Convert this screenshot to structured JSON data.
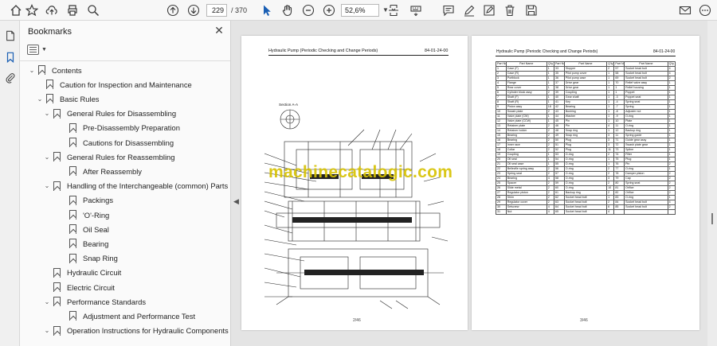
{
  "toolbar": {
    "page_current": "229",
    "page_total": "/ 370",
    "zoom": "52,6%"
  },
  "bookmarks_panel": {
    "title": "Bookmarks",
    "items": [
      {
        "label": "Contents",
        "level": 0,
        "expanded": true
      },
      {
        "label": "Caution for Inspection and Maintenance",
        "level": 1,
        "expanded": null
      },
      {
        "label": "Basic Rules",
        "level": 1,
        "expanded": true
      },
      {
        "label": "General Rules for Disassembling",
        "level": 2,
        "expanded": true
      },
      {
        "label": "Pre-Disassembly Preparation",
        "level": 3,
        "expanded": null
      },
      {
        "label": "Cautions for Disassembling",
        "level": 3,
        "expanded": null
      },
      {
        "label": "General Rules for Reassembling",
        "level": 2,
        "expanded": true
      },
      {
        "label": "After Reassembly",
        "level": 3,
        "expanded": null
      },
      {
        "label": "Handling of the Interchangeable (common) Parts",
        "level": 2,
        "expanded": true
      },
      {
        "label": "Packings",
        "level": 3,
        "expanded": null
      },
      {
        "label": "'O'-Ring",
        "level": 3,
        "expanded": null
      },
      {
        "label": "Oil Seal",
        "level": 3,
        "expanded": null
      },
      {
        "label": "Bearing",
        "level": 3,
        "expanded": null
      },
      {
        "label": "Snap Ring",
        "level": 3,
        "expanded": null
      },
      {
        "label": "Hydraulic Circuit",
        "level": 2,
        "expanded": null
      },
      {
        "label": "Electric Circuit",
        "level": 2,
        "expanded": null
      },
      {
        "label": "Performance Standards",
        "level": 2,
        "expanded": true
      },
      {
        "label": "Adjustment and Performance Test",
        "level": 3,
        "expanded": null
      },
      {
        "label": "Operation Instructions for Hydraulic Components at Starting",
        "level": 2,
        "expanded": true
      }
    ]
  },
  "document": {
    "left_page": {
      "header_title": "Hydraulic Pump (Periodic Checking and Change Periods)",
      "header_code": "84-01-24-00",
      "section_label": "Section A-A",
      "footer": "2/46"
    },
    "right_page": {
      "header_title": "Hydraulic Pump (Periodic Checking and Change Periods)",
      "header_code": "84-01-24-00",
      "footer": "3/46",
      "table_headers": [
        "Part No",
        "Part Name",
        "Q'ty",
        "Part No",
        "Part Name",
        "Q'ty",
        "Part No",
        "Part Name",
        "Q'ty"
      ],
      "rows": [
        [
          "1",
          "Case (F)",
          "1",
          "33",
          "Stopper",
          "2",
          "57",
          "Socket head bolt",
          "4"
        ],
        [
          "2",
          "Case (R)",
          "1",
          "35",
          "Pilot pump cover",
          "1",
          "58",
          "Socket head bolt",
          "4"
        ],
        [
          "3",
          "Portblock",
          "1",
          "36",
          "Pilot pump case",
          "1",
          "69",
          "Socket head bolt",
          "2"
        ],
        [
          "4",
          "Flange",
          "1",
          "37",
          "Drive gear",
          "1",
          "70",
          "Relief valve assy",
          "1"
        ],
        [
          "5",
          "Rear cover",
          "1",
          "38",
          "Drive gear",
          "1",
          "1",
          "Relief housing",
          "1"
        ],
        [
          "6",
          "Cylinder block assy",
          "2",
          "39",
          "Coupling",
          "1",
          "1",
          "Poppet",
          "1"
        ],
        [
          "7",
          "Shaft (F)",
          "1",
          "40",
          "Gear shaft",
          "1",
          "-3",
          "Poppet seat",
          "1"
        ],
        [
          "8",
          "Shaft (R)",
          "1",
          "41",
          "Key",
          "1",
          "-4",
          "Spring seat",
          "1"
        ],
        [
          "9",
          "Piston assy",
          "18",
          "42",
          "Bearing",
          "1",
          "-7",
          "Spring",
          "1"
        ],
        [
          "10",
          "Swash plate",
          "2",
          "43",
          "Bushing",
          "1",
          "-8",
          "Adjuster nut",
          "1"
        ],
        [
          "11",
          "Valve plate (CW)",
          "1",
          "44",
          "Washer",
          "1",
          "-9",
          "O-ring",
          "1"
        ],
        [
          "12",
          "Valve plate (CCW)",
          "1",
          "45",
          "Pin",
          "1",
          "10",
          "Plate",
          "1"
        ],
        [
          "13",
          "Retainer plate",
          "2",
          "46",
          "Pin",
          "4",
          "11",
          "O-ring",
          "1"
        ],
        [
          "14",
          "Retainer holder",
          "2",
          "48",
          "Snap ring",
          "1",
          "12",
          "Backup ring",
          "1"
        ],
        [
          "15",
          "Bearing",
          "2",
          "49",
          "Snap ring",
          "3",
          "11",
          "Spring guide",
          "1"
        ],
        [
          "16",
          "Bearing",
          "2",
          "50",
          "Plug",
          "3",
          "71",
          "Guide gear assy",
          "1"
        ],
        [
          "17",
          "Inner race",
          "2",
          "51",
          "Plug",
          "3",
          "72",
          "Swash plate gear",
          "1"
        ],
        [
          "18",
          "Collar",
          "2",
          "52",
          "Plug",
          "11",
          "73",
          "Spline",
          "1"
        ],
        [
          "19",
          "Coupling",
          "1",
          "53",
          "O-ring",
          "2",
          "74",
          "Filter",
          "1"
        ],
        [
          "20",
          "Oil seal",
          "1",
          "54",
          "O-ring",
          "1",
          "75",
          "Plug",
          "1"
        ],
        [
          "21",
          "Oil seal case",
          "1",
          "55",
          "O-ring",
          "1",
          "76",
          "Pin",
          "2"
        ],
        [
          "22",
          "Belleville spring assy",
          "2",
          "56",
          "O-ring",
          "2",
          "77",
          "O-ring",
          "1"
        ],
        [
          "23",
          "Spring seat",
          "2",
          "57",
          "O-ring",
          "2",
          "78",
          "Damper piston",
          "2"
        ],
        [
          "24",
          "Bearing",
          "4",
          "58",
          "O-ring",
          "3",
          "79",
          "Cap",
          "2"
        ],
        [
          "25",
          "Spacer",
          "2",
          "59",
          "O-ring",
          "2",
          "80",
          "Spring seat",
          "2"
        ],
        [
          "26",
          "Slide metal",
          "2",
          "60",
          "O-ring",
          "10",
          "81",
          "Orifice",
          "2"
        ],
        [
          "27",
          "Regulator piston",
          "2",
          "61",
          "Backup ring",
          "2",
          "82",
          "Orifice",
          "2"
        ],
        [
          "28",
          "Shim",
          "2",
          "62",
          "Socket head bolt",
          "1",
          "83",
          "O-ring",
          "1"
        ],
        [
          "29",
          "Regulator cover",
          "2",
          "63",
          "Socket head bolt",
          "2",
          "84",
          "Socket head bolt",
          "4"
        ],
        [
          "30",
          "Setscrew",
          "4",
          "64",
          "Socket head bolt",
          "6",
          "85",
          "Socket head bolt",
          "2"
        ],
        [
          "31",
          "Nut",
          "4",
          "65",
          "Socket head bolt",
          "4",
          "",
          "",
          ""
        ]
      ]
    },
    "watermark": "machinecatalogic.com"
  },
  "colors": {
    "accent": "#1a5fb4",
    "watermark": "#d7c200"
  }
}
